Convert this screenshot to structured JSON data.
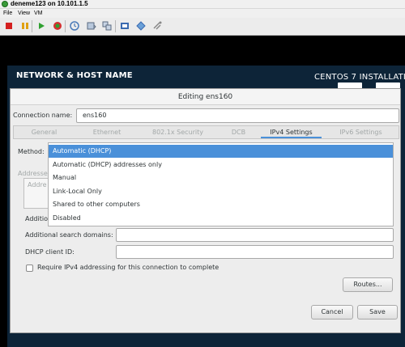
{
  "window": {
    "title": "deneme123 on 10.101.1.5",
    "menus": [
      "File",
      "View",
      "VM"
    ]
  },
  "toolbar": {
    "icons": [
      "stop-icon",
      "pause-icon",
      "play-icon",
      "reset-icon",
      "snapshot-icon",
      "revert-snapshot-icon",
      "manage-snapshots-icon",
      "send-ctrl-alt-del-icon",
      "fullscreen-icon",
      "connect-device-icon"
    ]
  },
  "installer": {
    "section_title": "NETWORK & HOST NAME",
    "product_title": "CENTOS 7 INSTALLATIO"
  },
  "dialog": {
    "title": "Editing ens160",
    "connection_name_label": "Connection name:",
    "connection_name_value": "ens160",
    "tabs": [
      {
        "label": "General",
        "active": false
      },
      {
        "label": "Ethernet",
        "active": false
      },
      {
        "label": "802.1x Security",
        "active": false
      },
      {
        "label": "DCB",
        "active": false
      },
      {
        "label": "IPv4 Settings",
        "active": true
      },
      {
        "label": "IPv6 Settings",
        "active": false
      }
    ],
    "method_label": "Method:",
    "addresses_label": "Addresse",
    "address_column_label": "Addre",
    "additional_dns_label": "Addition",
    "search_domains_label": "Additional search domains:",
    "search_domains_value": "",
    "dhcp_client_id_label": "DHCP client ID:",
    "dhcp_client_id_value": "",
    "require_ipv4_label": "Require IPv4 addressing for this connection to complete",
    "require_ipv4_checked": false,
    "routes_button": "Routes...",
    "cancel_button": "Cancel",
    "save_button": "Save"
  },
  "method_dropdown": {
    "options": [
      {
        "label": "Automatic (DHCP)",
        "selected": true
      },
      {
        "label": "Automatic (DHCP) addresses only",
        "selected": false
      },
      {
        "label": "Manual",
        "selected": false
      },
      {
        "label": "Link-Local Only",
        "selected": false
      },
      {
        "label": "Shared to other computers",
        "selected": false
      },
      {
        "label": "Disabled",
        "selected": false
      }
    ]
  },
  "colors": {
    "selection": "#4a90d9",
    "installer_header": "#0d2438",
    "dialog_background": "#ededed"
  }
}
